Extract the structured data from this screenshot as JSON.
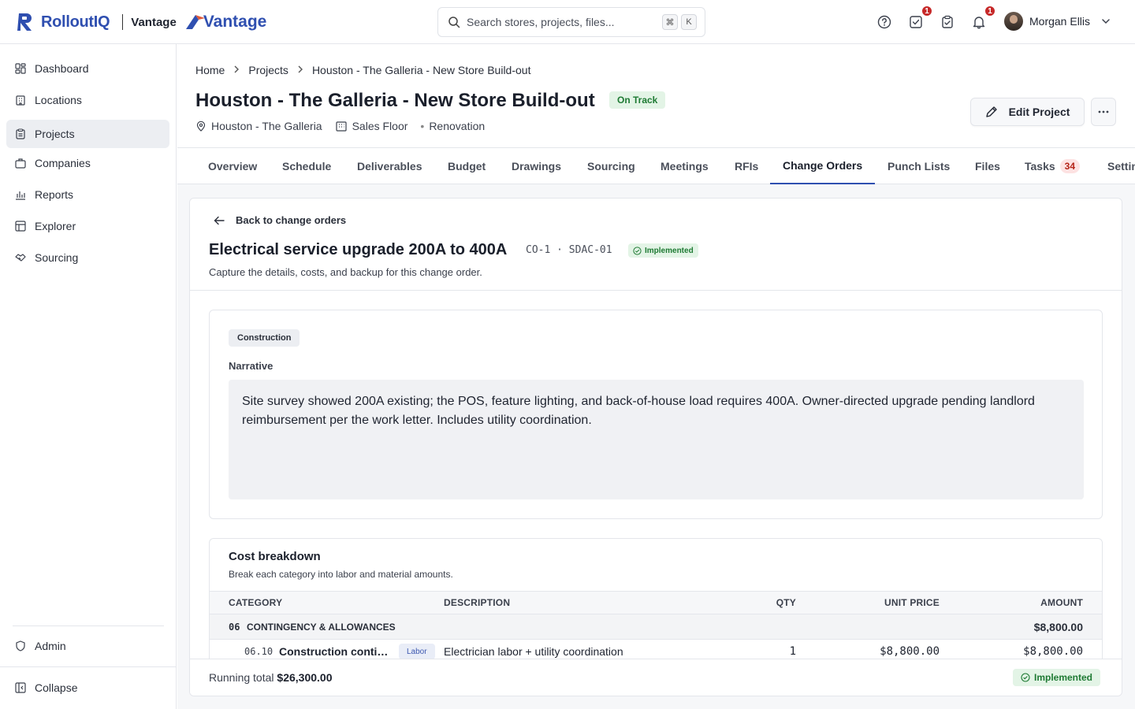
{
  "brand": {
    "app_name": "RolloutIQ",
    "tenant_label": "Vantage",
    "tenant_logo_text": "Vantage",
    "accent_color": "#2f4fb0"
  },
  "search": {
    "placeholder": "Search stores, projects, files...",
    "shortcut_keys": [
      "⌘",
      "K"
    ]
  },
  "top_icons": {
    "help": "help-icon",
    "approvals": {
      "icon": "checkbox-icon",
      "badge": "1"
    },
    "clipboard": "clipboard-check-icon",
    "notifications": {
      "icon": "bell-icon",
      "badge": "1"
    }
  },
  "user": {
    "name": "Morgan Ellis"
  },
  "sidebar": {
    "items": [
      {
        "label": "Dashboard",
        "icon": "dashboard-icon"
      },
      {
        "label": "Locations",
        "icon": "building-icon"
      },
      {
        "label": "Projects",
        "icon": "clipboard-icon",
        "active": true
      },
      {
        "label": "Companies",
        "icon": "briefcase-icon"
      },
      {
        "label": "Reports",
        "icon": "bar-chart-icon"
      },
      {
        "label": "Explorer",
        "icon": "table-icon"
      },
      {
        "label": "Sourcing",
        "icon": "handshake-icon"
      }
    ],
    "admin_label": "Admin",
    "collapse_label": "Collapse"
  },
  "breadcrumb": [
    "Home",
    "Projects",
    "Houston - The Galleria - New Store Build-out"
  ],
  "project": {
    "title": "Houston - The Galleria - New Store Build-out",
    "status": "On Track",
    "location": "Houston - The Galleria",
    "area": "Sales Floor",
    "type": "Renovation",
    "edit_label": "Edit Project"
  },
  "tabs": [
    {
      "label": "Overview"
    },
    {
      "label": "Schedule"
    },
    {
      "label": "Deliverables"
    },
    {
      "label": "Budget"
    },
    {
      "label": "Drawings"
    },
    {
      "label": "Sourcing"
    },
    {
      "label": "Meetings"
    },
    {
      "label": "RFIs"
    },
    {
      "label": "Change Orders",
      "active": true
    },
    {
      "label": "Punch Lists"
    },
    {
      "label": "Files"
    },
    {
      "label": "Tasks",
      "count": "34"
    },
    {
      "label": "Settings"
    }
  ],
  "change_order": {
    "back_label": "Back to change orders",
    "title": "Electrical service upgrade 200A to 400A",
    "code": "CO-1 · SDAC-01",
    "status": "Implemented",
    "subtitle": "Capture the details, costs, and backup for this change order.",
    "category_tag": "Construction",
    "narrative_label": "Narrative",
    "narrative": "Site survey showed 200A existing; the POS, feature lighting, and back-of-house load requires 400A. Owner-directed upgrade pending landlord reimbursement per the work letter. Includes utility coordination."
  },
  "cost_breakdown": {
    "title": "Cost breakdown",
    "subtitle": "Break each category into labor and material amounts.",
    "columns": [
      "CATEGORY",
      "DESCRIPTION",
      "QTY",
      "UNIT PRICE",
      "AMOUNT"
    ],
    "groups": [
      {
        "code": "06",
        "name": "CONTINGENCY & ALLOWANCES",
        "total": "$8,800.00",
        "items": [
          {
            "code": "06.10",
            "name": "Construction conti…",
            "kind": "Labor",
            "description": "Electrician labor + utility coordination",
            "qty": "1",
            "unit_price": "$8,800.00",
            "amount": "$8,800.00"
          }
        ]
      }
    ],
    "running_total_label": "Running total",
    "running_total": "$26,300.00",
    "footer_status": "Implemented"
  }
}
